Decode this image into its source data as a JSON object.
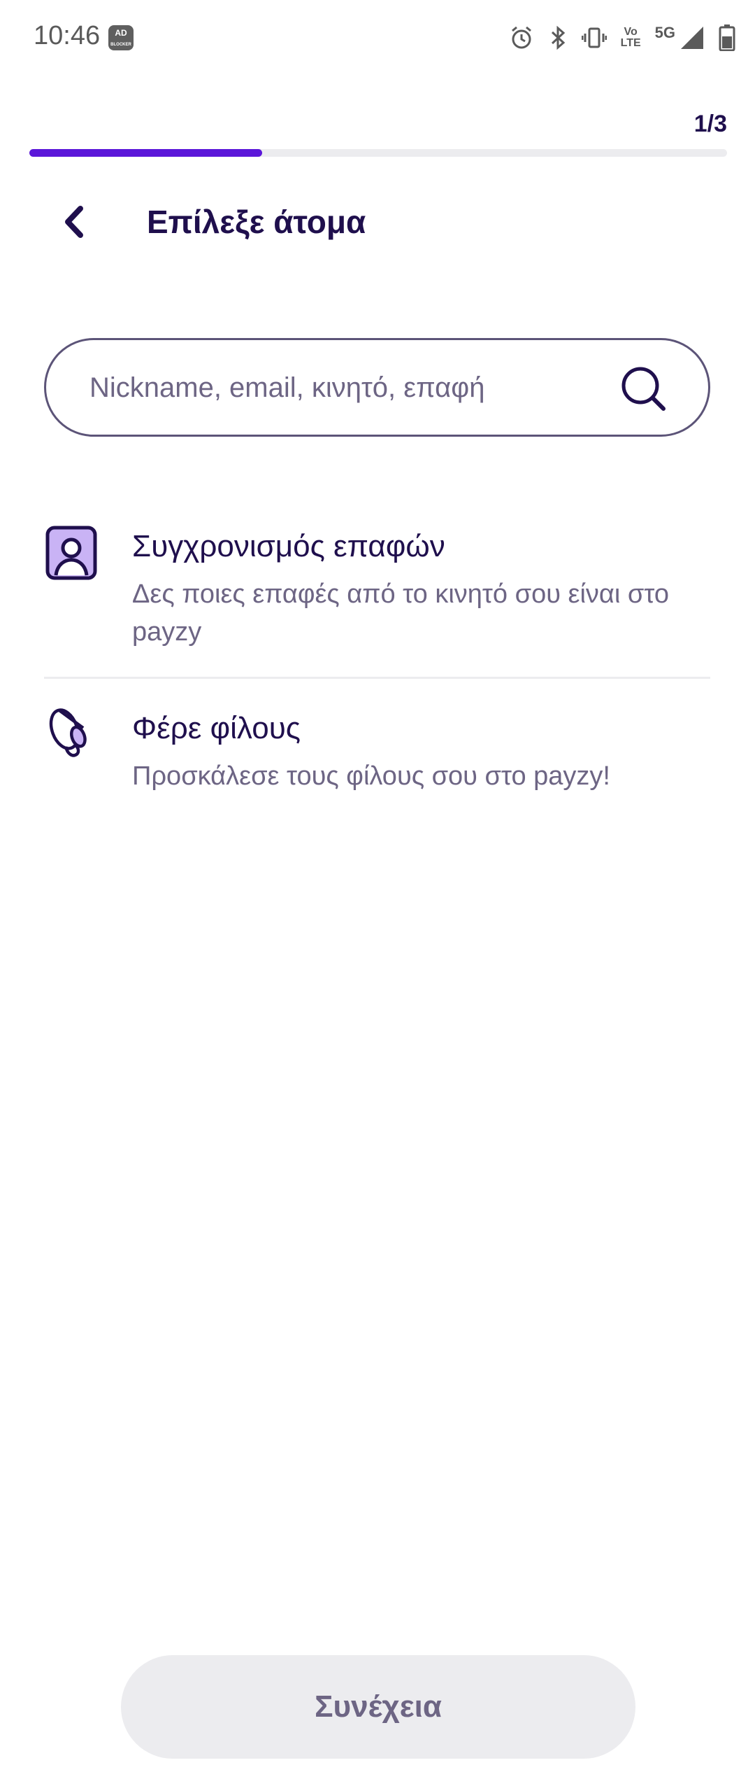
{
  "status_bar": {
    "time": "10:46",
    "adblock_badge": "AD BLOCKER",
    "lte_label_top": "Vo",
    "lte_label_bottom": "LTE",
    "network_label": "5G",
    "icons": [
      "alarm-icon",
      "bluetooth-icon",
      "vibrate-icon",
      "volte-icon",
      "signal-icon",
      "battery-icon"
    ]
  },
  "progress": {
    "label": "1/3",
    "fraction": 0.3333
  },
  "header": {
    "title": "Επίλεξε άτομα"
  },
  "search": {
    "placeholder": "Nickname, email, κινητό, επαφή",
    "value": ""
  },
  "list": {
    "items": [
      {
        "icon": "contact-sync-icon",
        "title": "Συγχρονισμός επαφών",
        "subtitle": "Δες ποιες επαφές από το κινητό σου είναι στο payzy"
      },
      {
        "icon": "megaphone-icon",
        "title": "Φέρε φίλους",
        "subtitle": "Προσκάλεσε τους φίλους σου στο payzy!"
      }
    ]
  },
  "footer": {
    "continue_label": "Συνέχεια"
  },
  "colors": {
    "accent": "#5b17d9",
    "text_primary": "#1f0f4d",
    "text_secondary": "#6d6584",
    "icon_fill": "#c9b3f5",
    "button_disabled_bg": "#ececef"
  }
}
